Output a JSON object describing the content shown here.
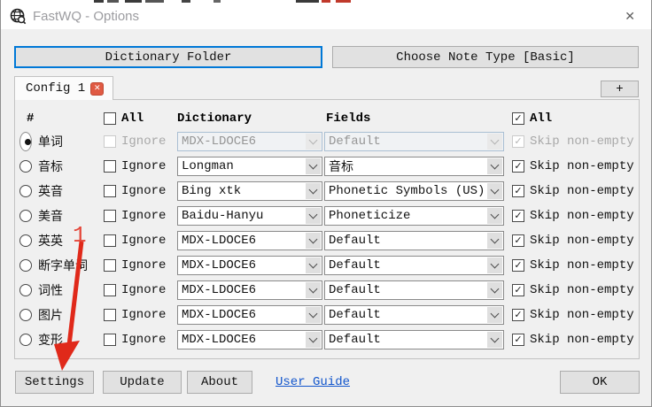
{
  "window": {
    "title": "FastWQ - Options",
    "close_glyph": "✕"
  },
  "actions": {
    "dictionary_folder_label": "Dictionary Folder",
    "choose_note_type_label": "Choose Note Type [Basic]"
  },
  "tab_bar": {
    "active_tab_label": "Config 1",
    "tab_close_glyph": "✕",
    "add_button_label": "+"
  },
  "table": {
    "header": {
      "number_label": "#",
      "all_ignore_label": "All",
      "all_ignore_checked": false,
      "dictionary_label": "Dictionary",
      "fields_label": "Fields",
      "all_skip_label": "All",
      "all_skip_checked": true
    },
    "ignore_label": "Ignore",
    "skip_label": "Skip non-empty",
    "rows": [
      {
        "label": "单词",
        "selected": true,
        "enabled": false,
        "ignore_checked": false,
        "dictionary": "MDX-LDOCE6",
        "field": "Default",
        "skip_checked": true
      },
      {
        "label": "音标",
        "selected": false,
        "enabled": true,
        "ignore_checked": false,
        "dictionary": "Longman",
        "field": "音标",
        "skip_checked": true
      },
      {
        "label": "英音",
        "selected": false,
        "enabled": true,
        "ignore_checked": false,
        "dictionary": "Bing xtk",
        "field": "Phonetic Symbols (US)",
        "skip_checked": true
      },
      {
        "label": "美音",
        "selected": false,
        "enabled": true,
        "ignore_checked": false,
        "dictionary": "Baidu-Hanyu",
        "field": "Phoneticize",
        "skip_checked": true
      },
      {
        "label": "英英",
        "selected": false,
        "enabled": true,
        "ignore_checked": false,
        "dictionary": "MDX-LDOCE6",
        "field": "Default",
        "skip_checked": true
      },
      {
        "label": "断字单词",
        "selected": false,
        "enabled": true,
        "ignore_checked": false,
        "dictionary": "MDX-LDOCE6",
        "field": "Default",
        "skip_checked": true
      },
      {
        "label": "词性",
        "selected": false,
        "enabled": true,
        "ignore_checked": false,
        "dictionary": "MDX-LDOCE6",
        "field": "Default",
        "skip_checked": true
      },
      {
        "label": "图片",
        "selected": false,
        "enabled": true,
        "ignore_checked": false,
        "dictionary": "MDX-LDOCE6",
        "field": "Default",
        "skip_checked": true
      },
      {
        "label": "变形",
        "selected": false,
        "enabled": true,
        "ignore_checked": false,
        "dictionary": "MDX-LDOCE6",
        "field": "Default",
        "skip_checked": true
      }
    ]
  },
  "footer": {
    "settings_label": "Settings",
    "update_label": "Update",
    "about_label": "About",
    "user_guide_label": "User Guide",
    "ok_label": "OK"
  },
  "annotation": {
    "step_label": "1"
  },
  "colors": {
    "accent_focus": "#0078d7",
    "annotation_red": "#e4473a",
    "link_blue": "#1155cc",
    "tab_close_red": "#e05a43",
    "dialog_bg": "#f0f0f0"
  }
}
